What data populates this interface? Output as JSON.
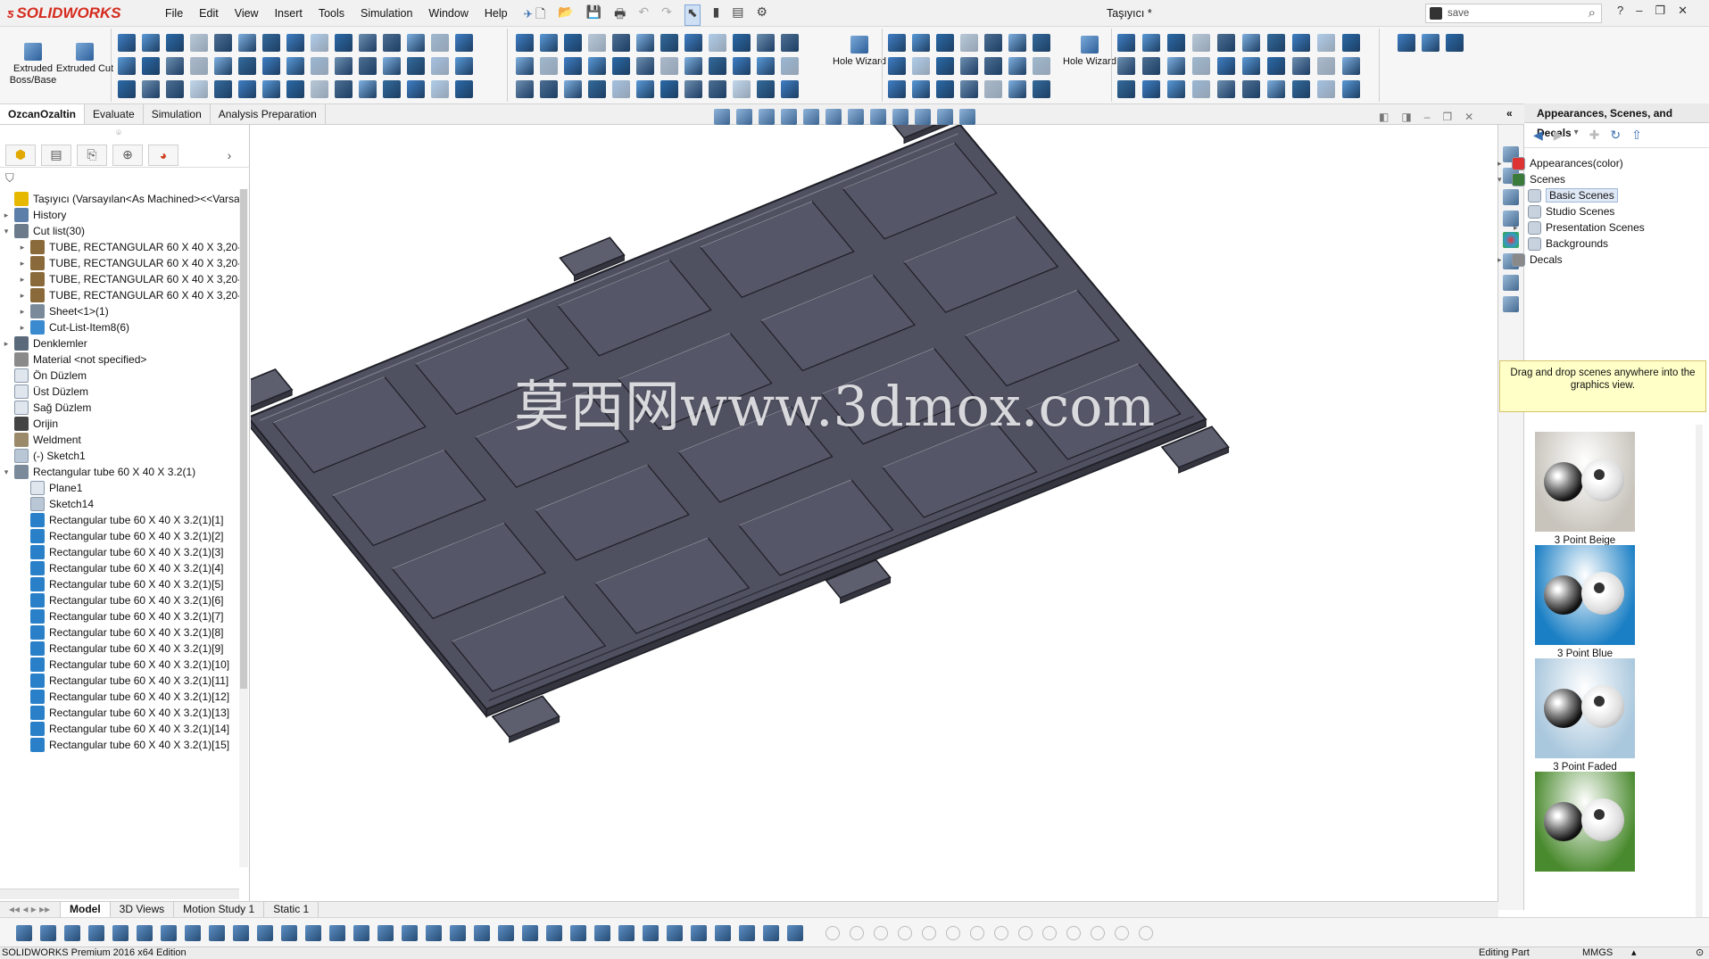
{
  "app": {
    "brand": "SOLIDWORKS",
    "doc_title": "Taşıyıcı *",
    "search_value": "save"
  },
  "menu": [
    "File",
    "Edit",
    "View",
    "Insert",
    "Tools",
    "Simulation",
    "Window",
    "Help"
  ],
  "commands": {
    "extruded_boss": "Extruded Boss/Base",
    "extruded_cut": "Extruded Cut",
    "hole_wizard_1": "Hole Wizard",
    "hole_wizard_2": "Hole Wizard"
  },
  "cmd_tabs": [
    "OzcanOzaltin",
    "Evaluate",
    "Simulation",
    "Analysis Preparation"
  ],
  "tree": {
    "root": "Taşıyıcı  (Varsayılan<As Machined><<Varsayı",
    "items": [
      {
        "label": "History",
        "level": 1,
        "exp": "▸",
        "icon": "history-icon"
      },
      {
        "label": "Cut list(30)",
        "level": 1,
        "exp": "▾",
        "icon": "cut-list-icon"
      },
      {
        "label": "TUBE, RECTANGULAR 60 X 40 X 3,20-",
        "level": 2,
        "exp": "▸",
        "icon": "weldment-member-icon"
      },
      {
        "label": "TUBE, RECTANGULAR 60 X 40 X 3,20-",
        "level": 2,
        "exp": "▸",
        "icon": "weldment-member-icon"
      },
      {
        "label": "TUBE, RECTANGULAR 60 X 40 X 3,20-",
        "level": 2,
        "exp": "▸",
        "icon": "weldment-member-icon"
      },
      {
        "label": "TUBE, RECTANGULAR 60 X 40 X 3,20-",
        "level": 2,
        "exp": "▸",
        "icon": "weldment-member-icon"
      },
      {
        "label": "Sheet<1>(1)",
        "level": 2,
        "exp": "▸",
        "icon": "sheet-icon"
      },
      {
        "label": "Cut-List-Item8(6)",
        "level": 2,
        "exp": "▸",
        "icon": "folder-icon"
      },
      {
        "label": "Denklemler",
        "level": 1,
        "exp": "▸",
        "icon": "equations-icon"
      },
      {
        "label": "Material <not specified>",
        "level": 1,
        "exp": "",
        "icon": "material-icon"
      },
      {
        "label": "Ön Düzlem",
        "level": 1,
        "exp": "",
        "icon": "plane-icon"
      },
      {
        "label": "Üst Düzlem",
        "level": 1,
        "exp": "",
        "icon": "plane-icon"
      },
      {
        "label": "Sağ Düzlem",
        "level": 1,
        "exp": "",
        "icon": "plane-icon"
      },
      {
        "label": "Orijin",
        "level": 1,
        "exp": "",
        "icon": "origin-icon"
      },
      {
        "label": "Weldment",
        "level": 1,
        "exp": "",
        "icon": "weldment-icon"
      },
      {
        "label": "(-) Sketch1",
        "level": 1,
        "exp": "",
        "icon": "sketch-icon"
      },
      {
        "label": "Rectangular tube 60 X 40 X 3.2(1)",
        "level": 1,
        "exp": "▾",
        "icon": "structural-member-icon"
      },
      {
        "label": "Plane1",
        "level": 2,
        "exp": "",
        "icon": "plane-icon"
      },
      {
        "label": "Sketch14",
        "level": 2,
        "exp": "",
        "icon": "sketch-icon"
      },
      {
        "label": "Rectangular tube 60 X 40 X 3.2(1)[1]",
        "level": 2,
        "exp": "",
        "icon": "body-icon"
      },
      {
        "label": "Rectangular tube 60 X 40 X 3.2(1)[2]",
        "level": 2,
        "exp": "",
        "icon": "body-icon"
      },
      {
        "label": "Rectangular tube 60 X 40 X 3.2(1)[3]",
        "level": 2,
        "exp": "",
        "icon": "body-icon"
      },
      {
        "label": "Rectangular tube 60 X 40 X 3.2(1)[4]",
        "level": 2,
        "exp": "",
        "icon": "body-icon"
      },
      {
        "label": "Rectangular tube 60 X 40 X 3.2(1)[5]",
        "level": 2,
        "exp": "",
        "icon": "body-icon"
      },
      {
        "label": "Rectangular tube 60 X 40 X 3.2(1)[6]",
        "level": 2,
        "exp": "",
        "icon": "body-icon"
      },
      {
        "label": "Rectangular tube 60 X 40 X 3.2(1)[7]",
        "level": 2,
        "exp": "",
        "icon": "body-icon"
      },
      {
        "label": "Rectangular tube 60 X 40 X 3.2(1)[8]",
        "level": 2,
        "exp": "",
        "icon": "body-icon"
      },
      {
        "label": "Rectangular tube 60 X 40 X 3.2(1)[9]",
        "level": 2,
        "exp": "",
        "icon": "body-icon"
      },
      {
        "label": "Rectangular tube 60 X 40 X 3.2(1)[10]",
        "level": 2,
        "exp": "",
        "icon": "body-icon"
      },
      {
        "label": "Rectangular tube 60 X 40 X 3.2(1)[11]",
        "level": 2,
        "exp": "",
        "icon": "body-icon"
      },
      {
        "label": "Rectangular tube 60 X 40 X 3.2(1)[12]",
        "level": 2,
        "exp": "",
        "icon": "body-icon"
      },
      {
        "label": "Rectangular tube 60 X 40 X 3.2(1)[13]",
        "level": 2,
        "exp": "",
        "icon": "body-icon"
      },
      {
        "label": "Rectangular tube 60 X 40 X 3.2(1)[14]",
        "level": 2,
        "exp": "",
        "icon": "body-icon"
      },
      {
        "label": "Rectangular tube 60 X 40 X 3.2(1)[15]",
        "level": 2,
        "exp": "",
        "icon": "body-icon"
      }
    ]
  },
  "watermark": "莫西网www.3dmox.com",
  "task_pane": {
    "title": "Appearances, Scenes, and Decals",
    "nodes": [
      {
        "label": "Appearances(color)",
        "level": 0,
        "exp": "▸",
        "icon": "appearance-icon"
      },
      {
        "label": "Scenes",
        "level": 0,
        "exp": "▾",
        "icon": "scenes-icon"
      },
      {
        "label": "Basic Scenes",
        "level": 1,
        "exp": "",
        "icon": "scene-folder-icon",
        "selected": true
      },
      {
        "label": "Studio Scenes",
        "level": 1,
        "exp": "",
        "icon": "scene-folder-icon"
      },
      {
        "label": "Presentation Scenes",
        "level": 1,
        "exp": "▸",
        "icon": "scene-folder-icon"
      },
      {
        "label": "Backgrounds",
        "level": 1,
        "exp": "",
        "icon": "scene-folder-icon"
      },
      {
        "label": "Decals",
        "level": 0,
        "exp": "▸",
        "icon": "decals-icon"
      }
    ],
    "note": "Drag and drop scenes anywhere into the graphics view.",
    "scenes": [
      {
        "label": "3 Point Beige",
        "color": "#c8c4bc"
      },
      {
        "label": "3 Point Blue",
        "color": "#1a7fc4"
      },
      {
        "label": "3 Point Faded",
        "color": "#a9c7dd"
      },
      {
        "label": "",
        "color": "#4a8a2e"
      }
    ]
  },
  "bottom_tabs": [
    "Model",
    "3D Views",
    "Motion Study 1",
    "Static 1"
  ],
  "status": {
    "edition": "SOLIDWORKS Premium 2016 x64 Edition",
    "mode": "Editing Part",
    "units": "MMGS"
  },
  "colors": {
    "model_face": "#4f5060",
    "model_edge": "#1e1f26",
    "brand_red": "#d52b1e"
  }
}
